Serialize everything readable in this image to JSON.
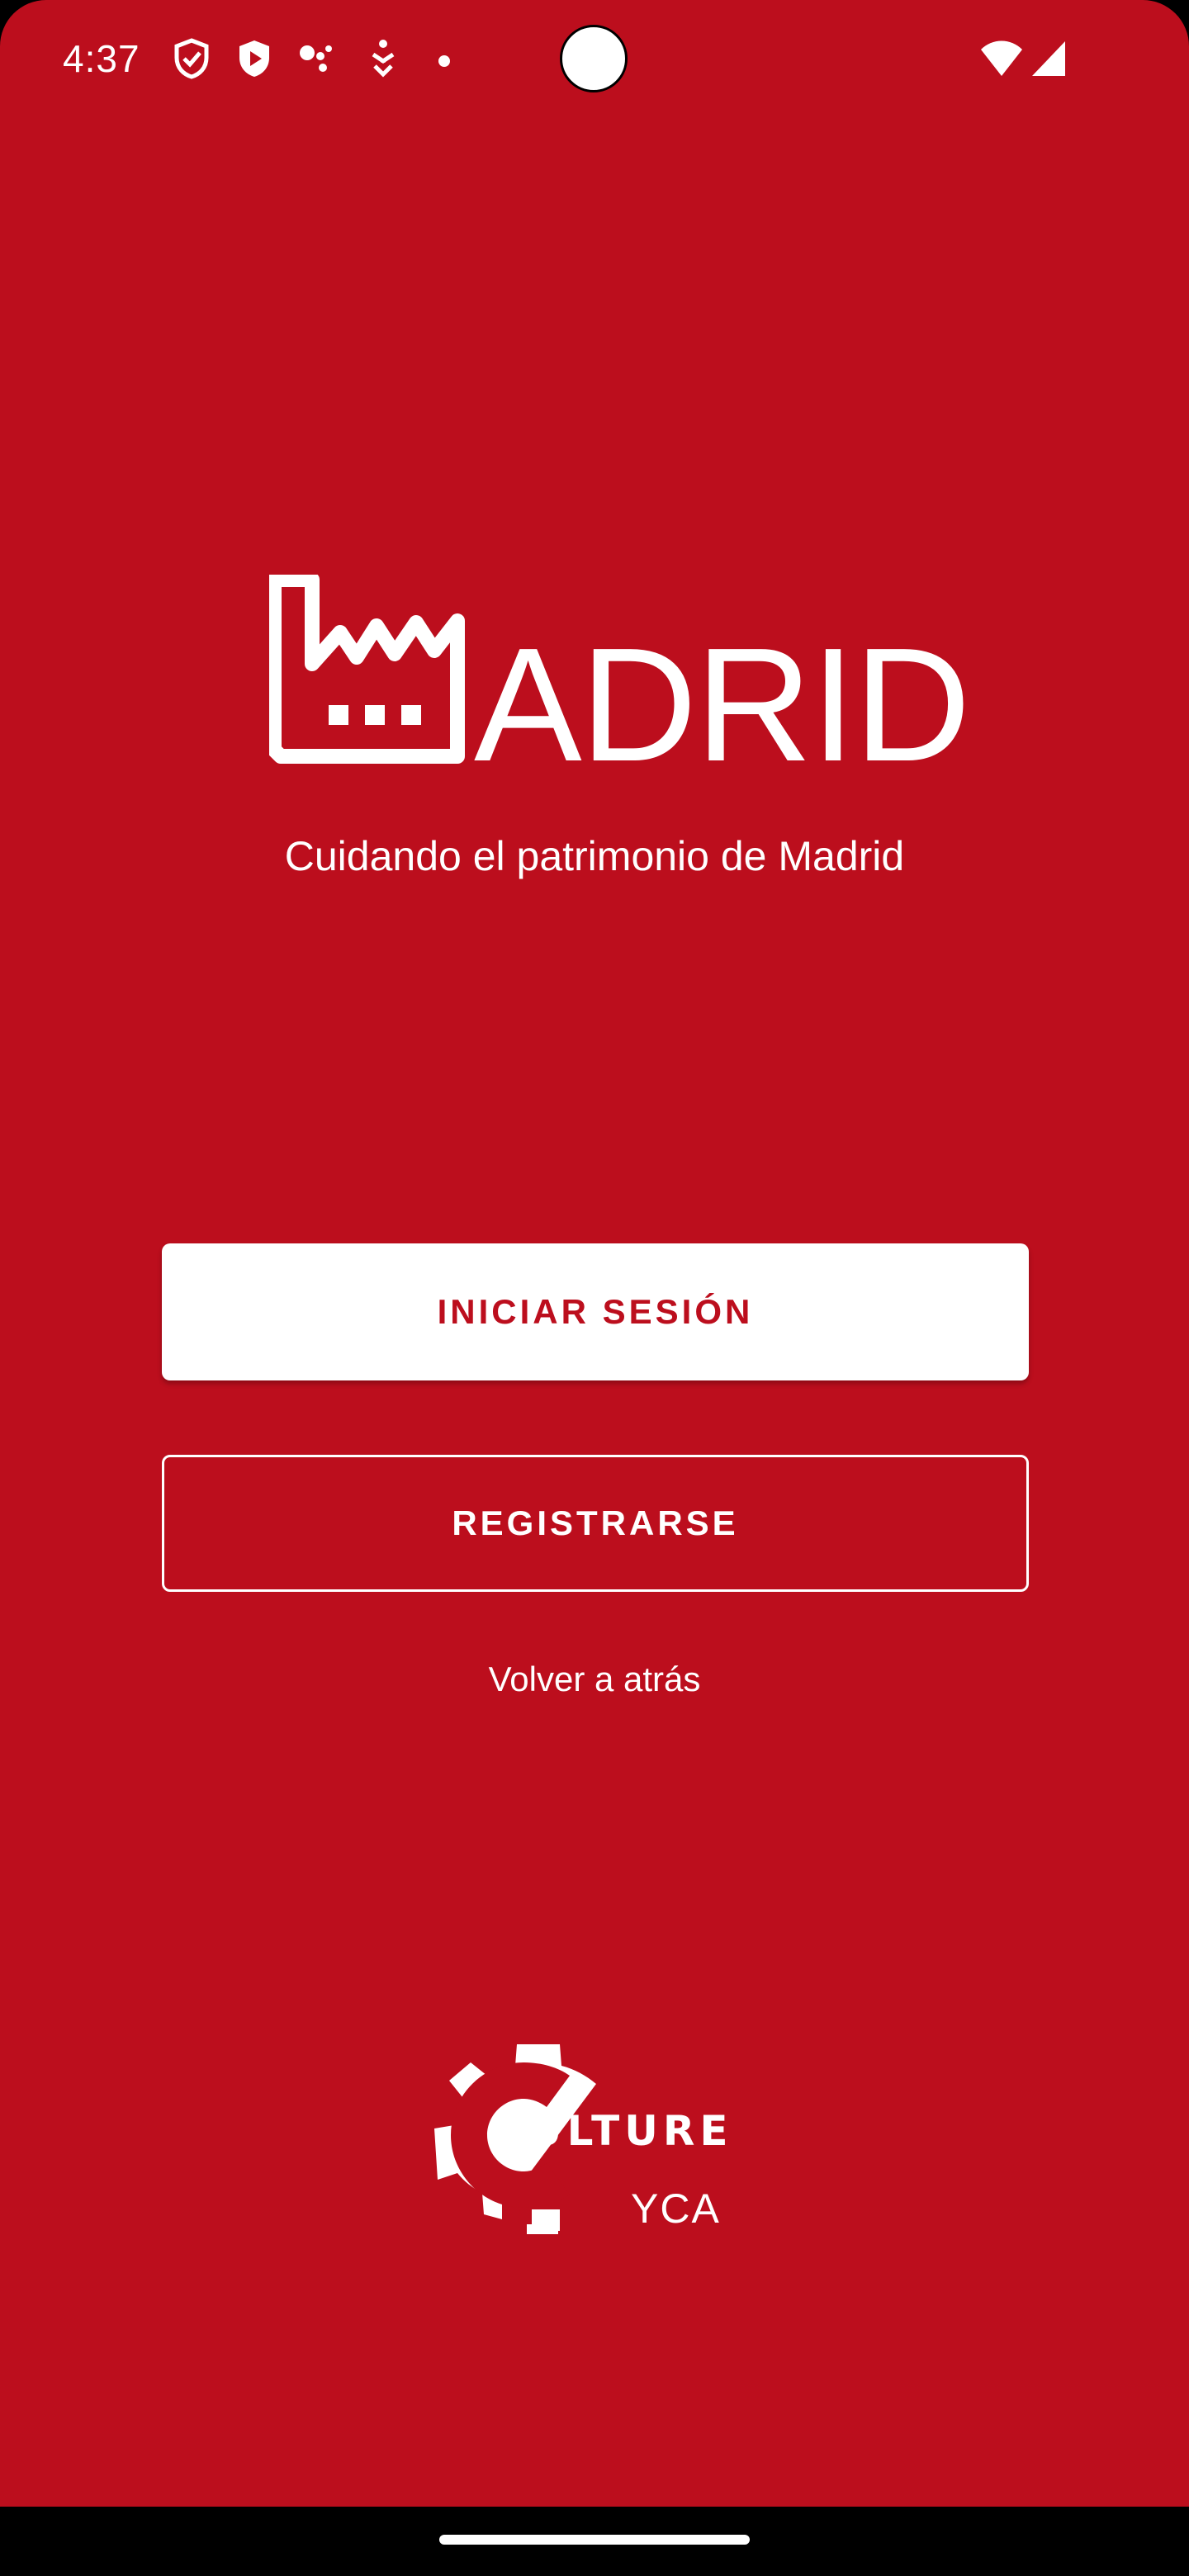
{
  "status_bar": {
    "time": "4:37",
    "icons": [
      "shield-check-icon",
      "shield-play-icon",
      "assistant-dots-icon",
      "accessibility-icon",
      "notification-dot-icon",
      "wifi-icon",
      "signal-icon"
    ]
  },
  "app": {
    "logo_word": "ADRID",
    "tagline": "Cuidando el patrimonio de Madrid",
    "login_label": "INICIAR SESIÓN",
    "register_label": "REGISTRARSE",
    "back_label": "Volver a atrás",
    "brand_word_1": "ULTURE",
    "brand_word_2": "YCA"
  },
  "colors": {
    "background": "#BC0E1D",
    "button_fill": "#FFFFFF",
    "text": "#FFFFFF"
  }
}
